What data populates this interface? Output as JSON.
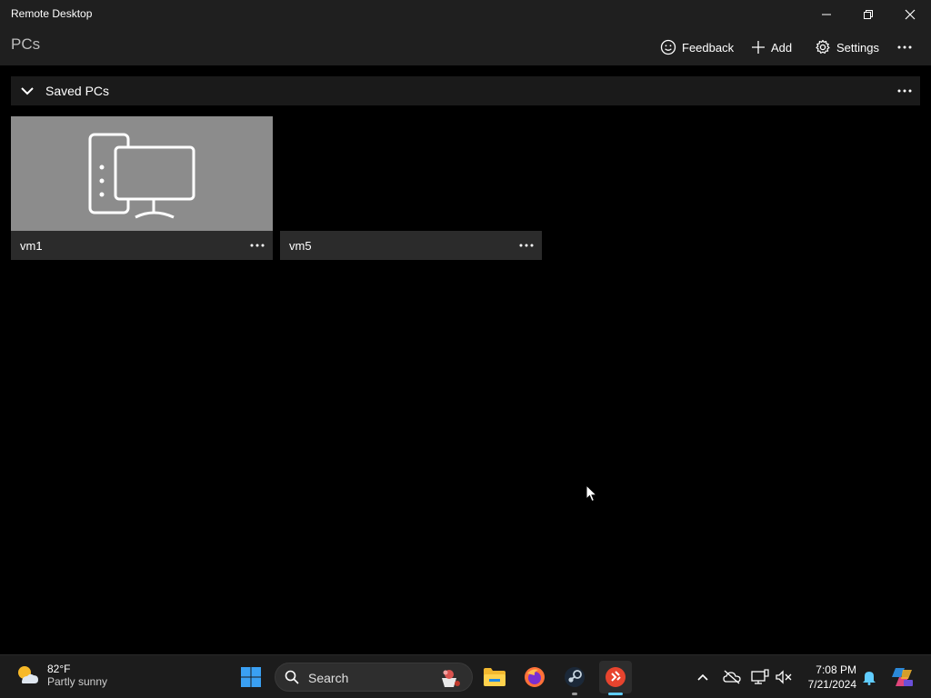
{
  "window": {
    "title": "Remote Desktop",
    "controls": [
      "minimize",
      "restore",
      "close"
    ]
  },
  "header": {
    "title": "PCs",
    "commands": [
      {
        "label": "Feedback",
        "icon": "smiley-icon"
      },
      {
        "label": "Add",
        "icon": "plus-icon"
      },
      {
        "label": "Settings",
        "icon": "gear-icon"
      }
    ],
    "more_icon": "more-icon"
  },
  "group": {
    "label": "Saved PCs",
    "expanded": true
  },
  "pcs": [
    {
      "name": "vm1",
      "has_thumbnail": true
    },
    {
      "name": "vm5",
      "has_thumbnail": false
    }
  ],
  "taskbar": {
    "weather": {
      "temp": "82°F",
      "condition": "Partly sunny"
    },
    "search_placeholder": "Search",
    "apps": [
      "start-icon",
      "file-explorer-icon",
      "firefox-icon",
      "steam-icon",
      "remote-desktop-icon"
    ],
    "tray": [
      "chevron-up-icon",
      "onedrive-icon",
      "network-icon",
      "volume-muted-icon"
    ],
    "clock": {
      "time": "7:08 PM",
      "date": "7/21/2024"
    }
  },
  "colors": {
    "background": "#000000",
    "chrome": "#1f1f1f",
    "tile_thumb": "#8c8c8c",
    "tile_bar": "#2b2b2b",
    "taskbar": "#1c1c1c",
    "accent": "#60cdff"
  }
}
